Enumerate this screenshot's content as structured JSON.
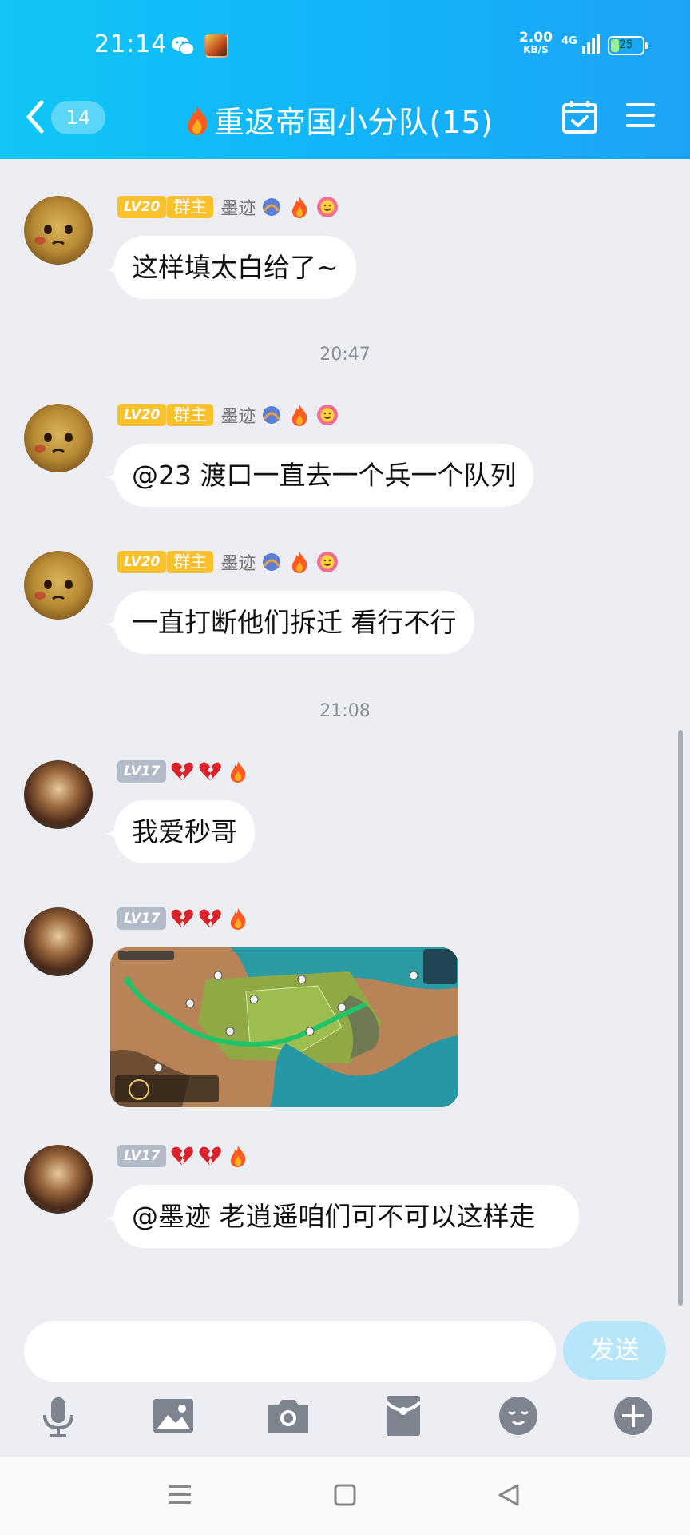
{
  "status_bar": {
    "time": "21:14",
    "net_speed_value": "2.00",
    "net_speed_unit": "KB/S",
    "network": "4G",
    "battery": "25",
    "battery_level": 0.25
  },
  "header": {
    "back_count": "14",
    "title": "重返帝国小分队(15)"
  },
  "messages": [
    {
      "level": "LV20",
      "role": "群主",
      "nickname": "墨迹",
      "text": "这样填太白给了~"
    },
    {
      "level": "LV20",
      "role": "群主",
      "nickname": "墨迹",
      "text": "@23 渡口一直去一个兵一个队列"
    },
    {
      "level": "LV20",
      "role": "群主",
      "nickname": "墨迹",
      "text": "一直打断他们拆迁 看行不行"
    },
    {
      "level": "LV17",
      "text": "我爱秒哥"
    },
    {
      "level": "LV17",
      "image": "game-map-screenshot"
    },
    {
      "level": "LV17",
      "text": "@墨迹 老逍遥咱们可不可以这样走"
    }
  ],
  "time_separators": [
    "20:47",
    "21:08"
  ],
  "composer": {
    "placeholder": "",
    "send_label": "发送"
  },
  "toolbar_icons": [
    "microphone-icon",
    "image-icon",
    "camera-icon",
    "red-packet-icon",
    "emoji-icon",
    "plus-icon"
  ],
  "colors": {
    "header_start": "#0fc6f6",
    "header_end": "#1da3f6",
    "owner_badge": "#fbc12b",
    "level_gray": "#b3bac8",
    "send_disabled": "#b7e6fb",
    "chat_bg": "#eceef3"
  }
}
